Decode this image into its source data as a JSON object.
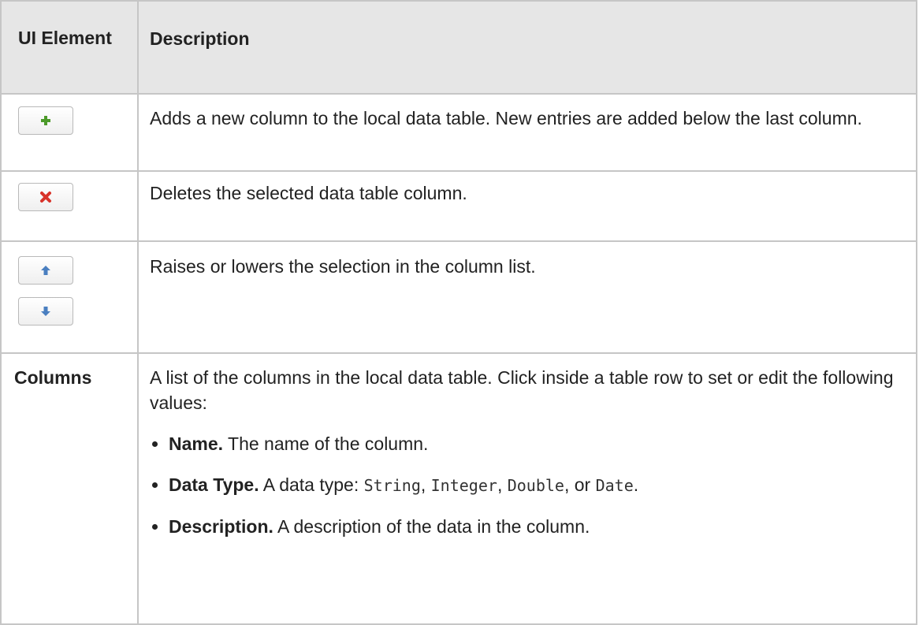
{
  "header": {
    "ui_element": "UI Element",
    "description": "Description"
  },
  "rows": {
    "add": {
      "icon": "add-green-plus-icon",
      "description": "Adds a new column to the local data table. New entries are added below the last column."
    },
    "delete": {
      "icon": "delete-red-x-icon",
      "description": "Deletes the selected data table column."
    },
    "move": {
      "icons": [
        "arrow-up-icon",
        "arrow-down-icon"
      ],
      "description": "Raises or lowers the selection in the column list."
    },
    "columns": {
      "label": "Columns",
      "intro": "A list of the columns in the local data table. Click inside a table row to set or edit the following values:",
      "items": [
        {
          "term": "Name.",
          "text": " The name of the column."
        },
        {
          "term": "Data Type.",
          "text_pre": " A data type: ",
          "types": [
            "String",
            "Integer",
            "Double",
            "Date"
          ],
          "sep1": ", ",
          "sep2": ", ",
          "sep3": ", or ",
          "end": "."
        },
        {
          "term": "Description.",
          "text": " A description of the data in the column."
        }
      ]
    }
  },
  "colors": {
    "header_bg": "#e6e6e6",
    "border": "#c6c6c6",
    "plus": "#4c9a2a",
    "x": "#d8332a",
    "arrow": "#4a7fc0"
  }
}
